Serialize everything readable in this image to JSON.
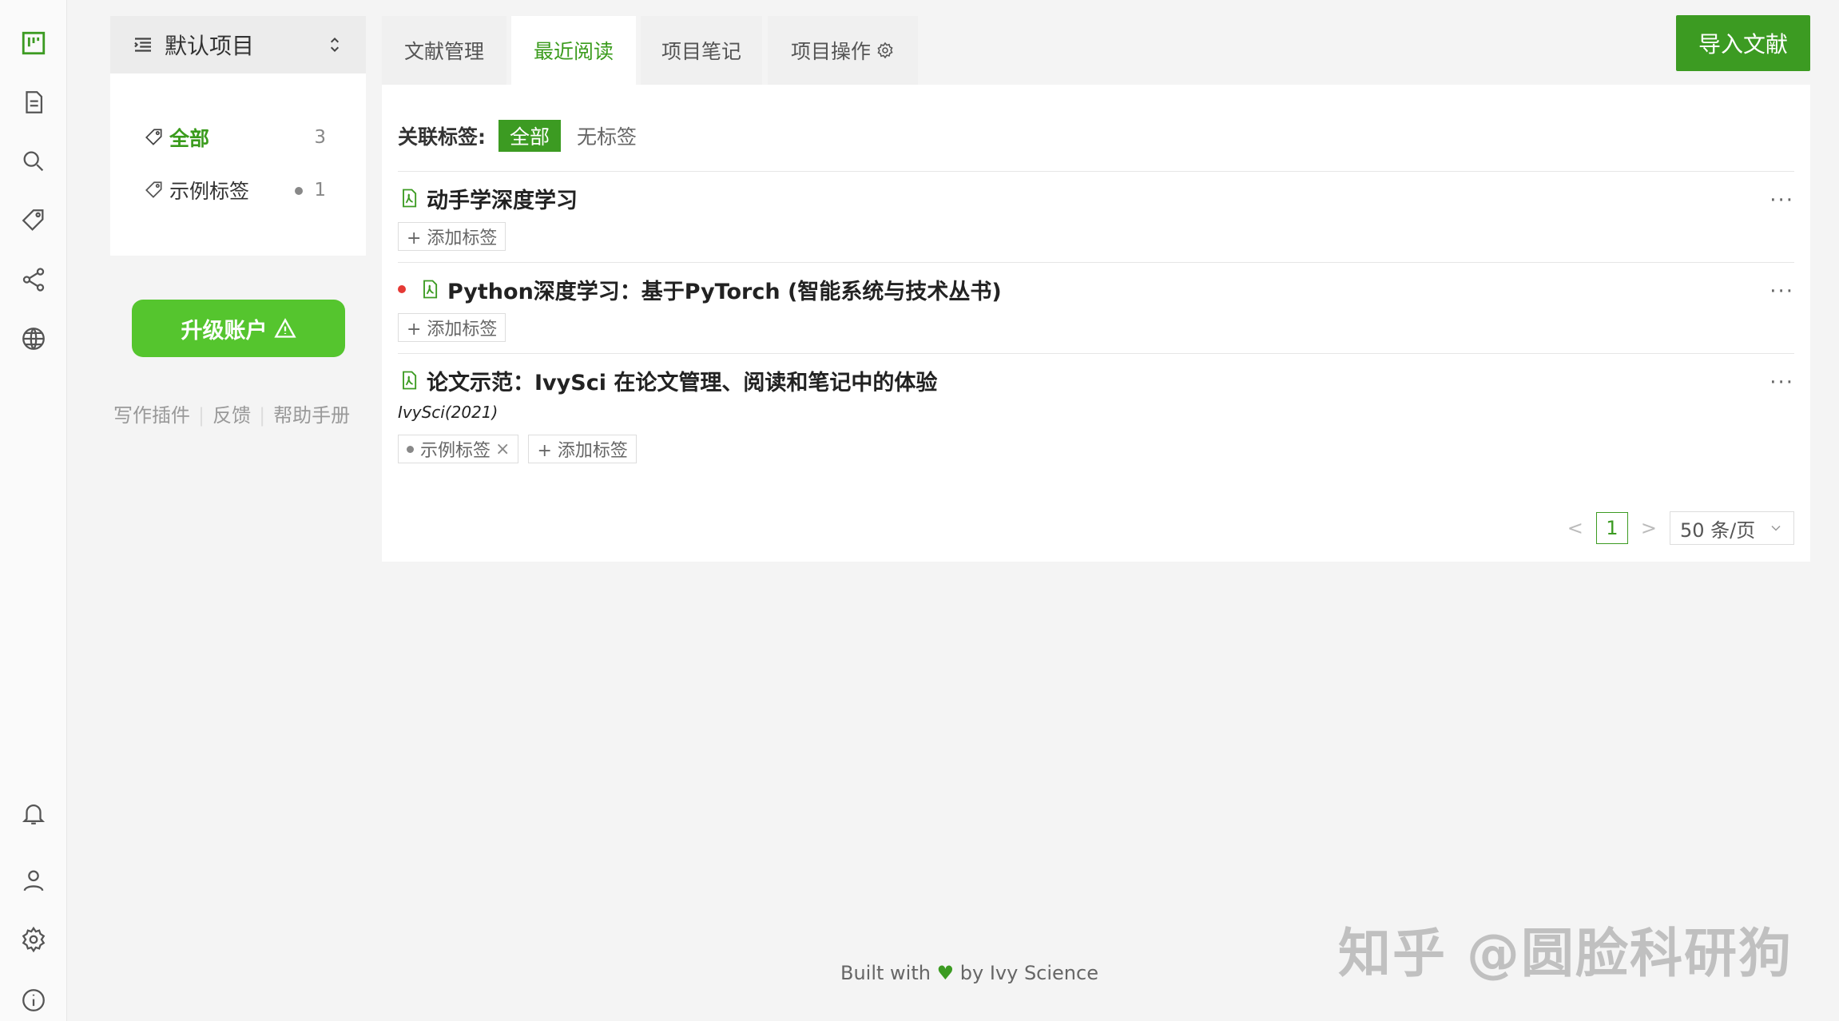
{
  "project": {
    "title": "默认项目"
  },
  "tags": [
    {
      "label": "全部",
      "count": "3"
    },
    {
      "label": "示例标签",
      "count": "1"
    }
  ],
  "upgrade_label": "升级账户",
  "links": {
    "plugin": "写作插件",
    "feedback": "反馈",
    "help": "帮助手册"
  },
  "tabs": [
    {
      "label": "文献管理"
    },
    {
      "label": "最近阅读"
    },
    {
      "label": "项目笔记"
    },
    {
      "label": "项目操作"
    }
  ],
  "import_label": "导入文献",
  "filter": {
    "label": "关联标签:",
    "all": "全部",
    "none": "无标签"
  },
  "documents": [
    {
      "title": "动手学深度学习",
      "add_tag": "+ 添加标签"
    },
    {
      "title": "Python深度学习：基于PyTorch (智能系统与技术丛书)",
      "add_tag": "+ 添加标签"
    },
    {
      "title": "论文示范：IvySci 在论文管理、阅读和笔记中的体验",
      "meta": "IvySci(2021)",
      "tag": "示例标签",
      "add_tag": "+ 添加标签"
    }
  ],
  "more": "···",
  "pager": {
    "page": "1",
    "size": "50 条/页",
    "prev": "<",
    "next": ">"
  },
  "footer": {
    "pre": "Built with",
    "heart": "♥",
    "post": "by Ivy Science"
  },
  "watermark": "知乎 @圆脸科研狗",
  "colors": {
    "accent": "#3c9b22",
    "button": "#55c52e",
    "unread": "#e53935"
  }
}
